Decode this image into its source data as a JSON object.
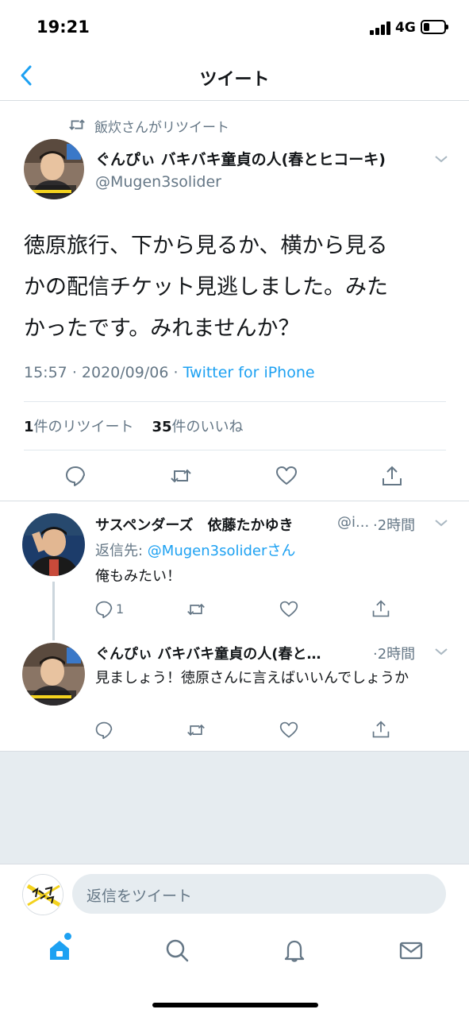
{
  "status_bar": {
    "time": "19:21",
    "network": "4G",
    "battery_level": 0.3
  },
  "nav": {
    "title": "ツイート",
    "back_icon": "chevron-left-icon"
  },
  "tweet": {
    "retweeted_by": "飯炊さんがリツイート",
    "author_name": "ぐんぴぃ バキバキ童貞の人(春とヒコーキ)",
    "author_handle": "@Mugen3solider",
    "text": "徳原旅行、下から見るか、横から見る\nかの配信チケット見逃しました。みた\nかったです。みれませんか？",
    "time": "15:57",
    "date": "2020/09/06",
    "source": "Twitter for iPhone",
    "retweet_count": "1",
    "retweet_label": "件のリツイート",
    "like_count": "35",
    "like_label": "件のいいね"
  },
  "replies": [
    {
      "author_name": "サスペンダーズ　依藤たかゆき",
      "author_handle": "@i...",
      "time": "2時間",
      "replying_prefix": "返信先: ",
      "replying_to": "@Mugen3solider",
      "replying_suffix": "さん",
      "text": "俺もみたい！",
      "reply_count": "1"
    },
    {
      "author_name": "ぐんぴぃ バキバキ童貞の人(春と…",
      "time": "2時間",
      "text": "見ましょう！徳原さんに言えばいいんでしょうか"
    }
  ],
  "composer": {
    "placeholder": "返信をツイート"
  },
  "tabbar": [
    "home-icon",
    "search-icon",
    "notifications-icon",
    "messages-icon"
  ],
  "colors": {
    "accent": "#1da1f2",
    "secondary_text": "#657786",
    "primary_text": "#14171a",
    "background_grey": "#e6ecf0"
  }
}
